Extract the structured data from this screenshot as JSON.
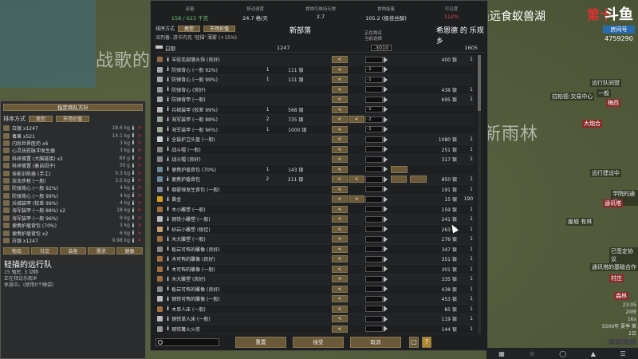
{
  "map": {
    "title_right": "遥远食蚁兽湖",
    "title_red": "第十",
    "big_text_1": "战歌的",
    "big_text_2": "新雨林",
    "brand_text": "斗鱼",
    "brand_sub": "房间号",
    "brand_num": "4759290",
    "labels": [
      "远行队同盟",
      "一般",
      "梅西",
      "拉帕德:交易中心",
      "大炮合",
      "远行建设中",
      "学院的通讯",
      "通讯塔",
      "废墟 有林",
      "已签定协议",
      "通讯塔的基础合作",
      "村庄",
      "森林"
    ]
  },
  "left_panel": {
    "plan_button": "指定商队方针",
    "sort_label": "排序方式",
    "sort_btn1": "类型",
    "sort_btn2": "市场价值",
    "items": [
      {
        "name": "白银 x1247",
        "weight": "18.6 kg"
      },
      {
        "name": "毒果 x521",
        "weight": "14.1 kg"
      },
      {
        "name": "闪烁世界医药 x6",
        "weight": "3 kg"
      },
      {
        "name": "心灵抚慰脉冲发生器",
        "weight": "3 kg"
      },
      {
        "name": "科研蛋置 (大脑链接) x2",
        "weight": "60 g"
      },
      {
        "name": "科研蛋置 (着自因子)",
        "weight": "30 g"
      },
      {
        "name": "技能训练器 (手工)",
        "weight": "0.3 kg"
      },
      {
        "name": "突击步枪 (一般)",
        "weight": "3.5 kg"
      },
      {
        "name": "防弹背心 (一般 92%)",
        "weight": "4 kg"
      },
      {
        "name": "防弹背心 (一般 99%)",
        "weight": "4 kg"
      },
      {
        "name": "兵械装甲 (较差 99%)",
        "weight": "4 kg"
      },
      {
        "name": "海军装甲 (一般 88%) x2",
        "weight": "18 kg"
      },
      {
        "name": "海军装甲 (一般 96%)",
        "weight": "9 kg"
      },
      {
        "name": "便携护盾背包 (70%)",
        "weight": "3 kg"
      },
      {
        "name": "便携护盾背包 x2",
        "weight": "6 kg"
      },
      {
        "name": "白银 x1247",
        "weight": "9.98 kg"
      }
    ],
    "tabs": [
      "物品",
      "社交",
      "装备",
      "需求",
      "健康"
    ],
    "group_name": "轻描的远行队",
    "group_sub1": "15 殖民, 3 动物",
    "group_sub2": "正在拜访乐观乡",
    "group_sub3": "休息中。(使用0个睡袋)"
  },
  "stats": [
    {
      "label": "容量",
      "value": "158 / 623 千克",
      "tone": "green"
    },
    {
      "label": "移动速度",
      "value": "24.7 格/天",
      "tone": ""
    },
    {
      "label": "食物可维持天数",
      "value": "2.7",
      "tone": ""
    },
    {
      "label": "食物能量",
      "value": "105.2 (极佳丝醇)",
      "tone": ""
    },
    {
      "label": "可见度",
      "value": "112%",
      "tone": "red"
    }
  ],
  "header": {
    "sort_label": "排序方式",
    "sort_btn1": "类型",
    "sort_btn2": "市场价值",
    "filter_text": "派列着: 游卡内克 '轻描' 薄雾 (+15%)",
    "left_title": "新部落",
    "mid_line1": "正在购买",
    "mid_line2": "当前选择",
    "right_title": "希恩德 的 乐观乡"
  },
  "silver": {
    "name": "白银",
    "colony_qty": "1247",
    "delta": "-3010",
    "trader_qty": "1605"
  },
  "trade_rows": [
    {
      "name": "羊驼毛部落头饰 (良好)",
      "cq": "",
      "cp": "",
      "buy": true,
      "buy2": false,
      "input": "",
      "rb": false,
      "rb2": false,
      "price": "400 银",
      "tq": "1"
    },
    {
      "name": "防弹背心 (一般 92%)",
      "cq": "1",
      "cp": "111 银",
      "buy": true,
      "buy2": false,
      "input": "-1",
      "rb": false,
      "rb2": false,
      "price": "",
      "tq": ""
    },
    {
      "name": "防弹背心 (一般 99%)",
      "cq": "1",
      "cp": "111 银",
      "buy": true,
      "buy2": false,
      "input": "-1",
      "rb": false,
      "rb2": false,
      "price": "",
      "tq": ""
    },
    {
      "name": "防弹背心 (良好)",
      "cq": "",
      "cp": "",
      "buy": true,
      "buy2": false,
      "input": "",
      "rb": false,
      "rb2": false,
      "price": "438 银",
      "tq": "1"
    },
    {
      "name": "防弹背甲 (一般)",
      "cq": "",
      "cp": "",
      "buy": true,
      "buy2": false,
      "input": "",
      "rb": false,
      "rb2": false,
      "price": "695 银",
      "tq": "1"
    },
    {
      "name": "兵械装甲 (较差 99%)",
      "cq": "1",
      "cp": "568 银",
      "buy": true,
      "buy2": false,
      "input": "-1",
      "rb": false,
      "rb2": false,
      "price": "",
      "tq": ""
    },
    {
      "name": "海军装甲 (一般 88%)",
      "cq": "2",
      "cp": "735 银",
      "buy": true,
      "buy2": true,
      "input": "-2",
      "rb": false,
      "rb2": false,
      "price": "",
      "tq": ""
    },
    {
      "name": "海军装甲 (一般 96%)",
      "cq": "1",
      "cp": "1000 银",
      "buy": true,
      "buy2": false,
      "input": "-1",
      "rb": false,
      "rb2": false,
      "price": "",
      "tq": ""
    },
    {
      "name": "全装护卫头盔 (一般)",
      "cq": "",
      "cp": "",
      "buy": true,
      "buy2": false,
      "input": "",
      "rb": false,
      "rb2": false,
      "price": "1080 银",
      "tq": "1"
    },
    {
      "name": "战斗帽 (一般)",
      "cq": "",
      "cp": "",
      "buy": true,
      "buy2": false,
      "input": "",
      "rb": false,
      "rb2": false,
      "price": "251 银",
      "tq": "1"
    },
    {
      "name": "战斗帽 (良好)",
      "cq": "",
      "cp": "",
      "buy": true,
      "buy2": false,
      "input": "",
      "rb": false,
      "rb2": false,
      "price": "317 银",
      "tq": "1"
    },
    {
      "name": "便携护盾背包 (70%)",
      "cq": "1",
      "cp": "143 银",
      "buy": true,
      "buy2": false,
      "input": "",
      "rb": true,
      "rb2": false,
      "price": "",
      "tq": ""
    },
    {
      "name": "便携护盾背包",
      "cq": "2",
      "cp": "211 银",
      "buy": true,
      "buy2": true,
      "input": "",
      "rb": true,
      "rb2": true,
      "price": "850 银",
      "tq": "1"
    },
    {
      "name": "烟雾弹发生背包 (一般)",
      "cq": "",
      "cp": "",
      "buy": true,
      "buy2": false,
      "input": "",
      "rb": false,
      "rb2": false,
      "price": "191 银",
      "tq": "1"
    },
    {
      "name": "黄金",
      "cq": "",
      "cp": "",
      "buy": true,
      "buy2": true,
      "input": "",
      "rb": false,
      "rb2": false,
      "price": "15 银",
      "tq": "190"
    },
    {
      "name": "木小雕塑 (一般)",
      "cq": "",
      "cp": "",
      "buy": true,
      "buy2": false,
      "input": "",
      "rb": false,
      "rb2": false,
      "price": "159 银",
      "tq": "1"
    },
    {
      "name": "钢铁小雕塑 (一般)",
      "cq": "",
      "cp": "",
      "buy": true,
      "buy2": false,
      "input": "",
      "rb": false,
      "rb2": false,
      "price": "241 银",
      "tq": "1"
    },
    {
      "name": "砂岩小雕塑 (极佳)",
      "cq": "",
      "cp": "",
      "buy": true,
      "buy2": false,
      "input": "",
      "rb": false,
      "rb2": false,
      "price": "263 银",
      "tq": "1"
    },
    {
      "name": "木大雕塑 (一般)",
      "cq": "",
      "cp": "",
      "buy": true,
      "buy2": false,
      "input": "",
      "rb": false,
      "rb2": false,
      "price": "276 银",
      "tq": "1"
    },
    {
      "name": "板岩可怖的雕像 (良好)",
      "cq": "",
      "cp": "",
      "buy": true,
      "buy2": false,
      "input": "",
      "rb": false,
      "rb2": false,
      "price": "347 银",
      "tq": "1"
    },
    {
      "name": "木可怖的雕像 (良好)",
      "cq": "",
      "cp": "",
      "buy": true,
      "buy2": false,
      "input": "",
      "rb": false,
      "rb2": false,
      "price": "351 银",
      "tq": "1"
    },
    {
      "name": "木可怖的雕像 (一般)",
      "cq": "",
      "cp": "",
      "buy": true,
      "buy2": false,
      "input": "",
      "rb": false,
      "rb2": false,
      "price": "301 银",
      "tq": "1"
    },
    {
      "name": "木大雕塑 (良好)",
      "cq": "",
      "cp": "",
      "buy": true,
      "buy2": false,
      "input": "",
      "rb": false,
      "rb2": false,
      "price": "335 银",
      "tq": "1"
    },
    {
      "name": "板岩可怖的雕像 (良好)",
      "cq": "",
      "cp": "",
      "buy": true,
      "buy2": false,
      "input": "",
      "rb": false,
      "rb2": false,
      "price": "438 银",
      "tq": "1"
    },
    {
      "name": "钢铁可怖的雕像 (一般)",
      "cq": "",
      "cp": "",
      "buy": true,
      "buy2": false,
      "input": "",
      "rb": false,
      "rb2": false,
      "price": "453 银",
      "tq": "1"
    },
    {
      "name": "木单人床 (一般)",
      "cq": "",
      "cp": "",
      "buy": true,
      "buy2": false,
      "input": "",
      "rb": false,
      "rb2": false,
      "price": "85 银",
      "tq": "1"
    },
    {
      "name": "钢铁单人床 (一般)",
      "cq": "",
      "cp": "",
      "buy": true,
      "buy2": false,
      "input": "",
      "rb": false,
      "rb2": false,
      "price": "119 银",
      "tq": "1"
    },
    {
      "name": "钢铁篝火火炭",
      "cq": "",
      "cp": "",
      "buy": true,
      "buy2": false,
      "input": "",
      "rb": false,
      "rb2": false,
      "price": "144 银",
      "tq": "1"
    }
  ],
  "footer": {
    "reset": "重置",
    "accept": "接受",
    "cancel": "取消",
    "search_placeholder": ""
  },
  "time": {
    "clock": "23:05",
    "day": "20时",
    "speed": "16x",
    "date": "5500年 夏季 第2日"
  }
}
